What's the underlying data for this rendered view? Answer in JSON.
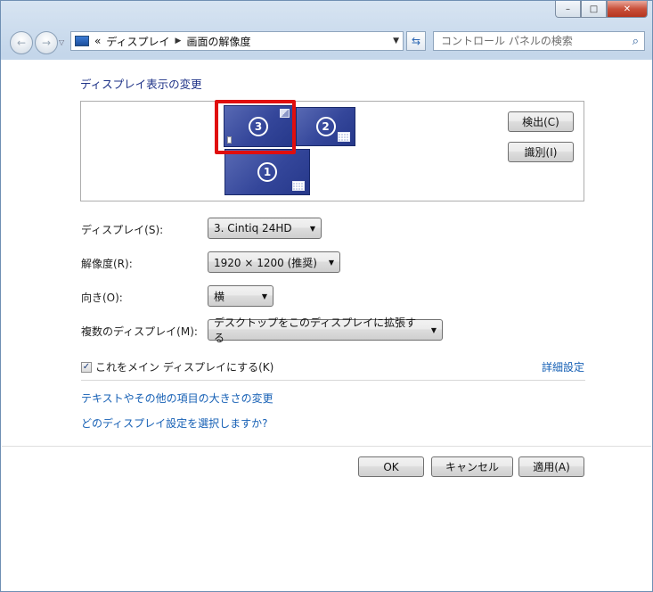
{
  "window": {
    "minimize_glyph": "–",
    "maximize_glyph": "□",
    "close_glyph": "✕"
  },
  "navbar": {
    "back_glyph": "←",
    "forward_glyph": "→",
    "recent_glyph": "▽",
    "breadcrumb_overflow": "«",
    "breadcrumb_sep": "▶",
    "breadcrumb": [
      "ディスプレイ",
      "画面の解像度"
    ],
    "address_drop_glyph": "▼",
    "refresh_glyph": "⇆",
    "search_placeholder": "コントロール パネルの検索",
    "search_glyph": "⌕"
  },
  "main": {
    "title": "ディスプレイ表示の変更",
    "monitors": [
      {
        "num": "3",
        "selected": true
      },
      {
        "num": "2",
        "selected": false
      },
      {
        "num": "1",
        "selected": false
      }
    ],
    "detect_button": "検出(C)",
    "identify_button": "識別(I)",
    "display_label": "ディスプレイ(S):",
    "display_value": "3. Cintiq 24HD",
    "resolution_label": "解像度(R):",
    "resolution_value": "1920 × 1200 (推奨)",
    "orientation_label": "向き(O):",
    "orientation_value": "横",
    "multiple_label": "複数のディスプレイ(M):",
    "multiple_value": "デスクトップをこのディスプレイに拡張する",
    "dropdown_glyph": "▼",
    "main_display_check_glyph": "✓",
    "main_display_checkbox": "これをメイン ディスプレイにする(K)",
    "main_display_checked": true,
    "advanced_link": "詳細設定",
    "text_size_link": "テキストやその他の項目の大きさの変更",
    "which_settings_link": "どのディスプレイ設定を選択しますか?"
  },
  "footer": {
    "ok": "OK",
    "cancel": "キャンセル",
    "apply": "適用(A)"
  },
  "colors": {
    "accent_link": "#1660b5",
    "title_blue": "#1e3287",
    "monitor_blue": "#34469a",
    "selection_red": "#e00e0e"
  }
}
